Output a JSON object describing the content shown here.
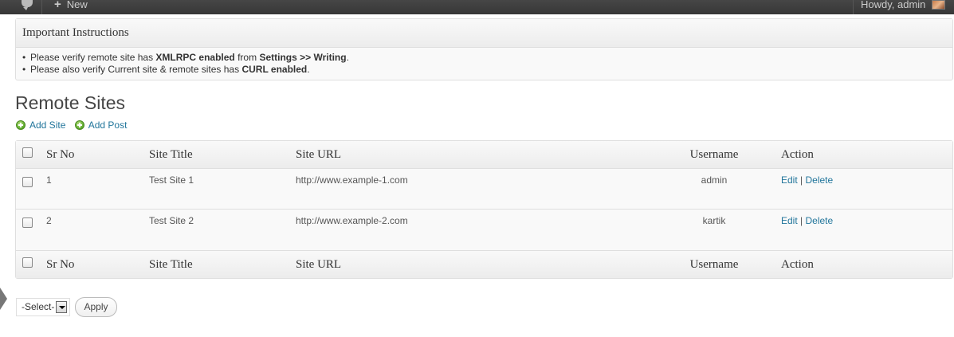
{
  "adminbar": {
    "new_label": "New",
    "howdy_label": "Howdy, admin"
  },
  "instructions": {
    "title": "Important Instructions",
    "line1": {
      "pre": "Please verify remote site has ",
      "bold1": "XMLRPC enabled",
      "mid": " from ",
      "bold2": "Settings >> Writing",
      "post": "."
    },
    "line2": {
      "pre": "Please also verify Current site & remote sites has ",
      "bold1": "CURL enabled",
      "post": "."
    }
  },
  "page_title": "Remote Sites",
  "links": {
    "add_site": "Add Site",
    "add_post": "Add Post"
  },
  "table": {
    "columns": {
      "sr_no": "Sr No",
      "site_title": "Site Title",
      "site_url": "Site URL",
      "username": "Username",
      "action": "Action"
    },
    "rows": [
      {
        "sr_no": "1",
        "site_title": "Test Site 1",
        "site_url": "http://www.example-1.com",
        "username": "admin",
        "edit": "Edit",
        "sep": "|",
        "delete": "Delete"
      },
      {
        "sr_no": "2",
        "site_title": "Test Site 2",
        "site_url": "http://www.example-2.com",
        "username": "kartik",
        "edit": "Edit",
        "sep": "|",
        "delete": "Delete"
      }
    ]
  },
  "bulk": {
    "select_value": "-Select-",
    "apply_label": "Apply"
  },
  "colors": {
    "link": "#21759b",
    "adminbar": "#464646",
    "border": "#dfdfdf"
  }
}
